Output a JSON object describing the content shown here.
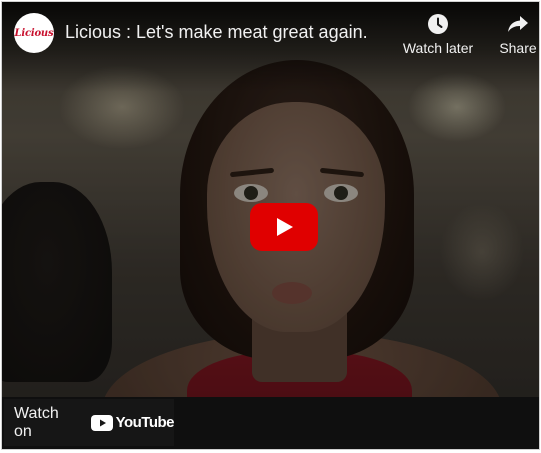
{
  "video": {
    "title": "Licious : Let's make meat great again."
  },
  "channel": {
    "logo_text": "Licious",
    "logo_color": "#c8102e"
  },
  "actions": {
    "watch_later": {
      "label": "Watch later",
      "icon": "clock-icon"
    },
    "share": {
      "label": "Share",
      "icon": "share-arrow-icon"
    }
  },
  "play_button": {
    "icon": "play-icon",
    "color": "#e00000"
  },
  "watch_on": {
    "label": "Watch on",
    "brand": "YouTube"
  }
}
